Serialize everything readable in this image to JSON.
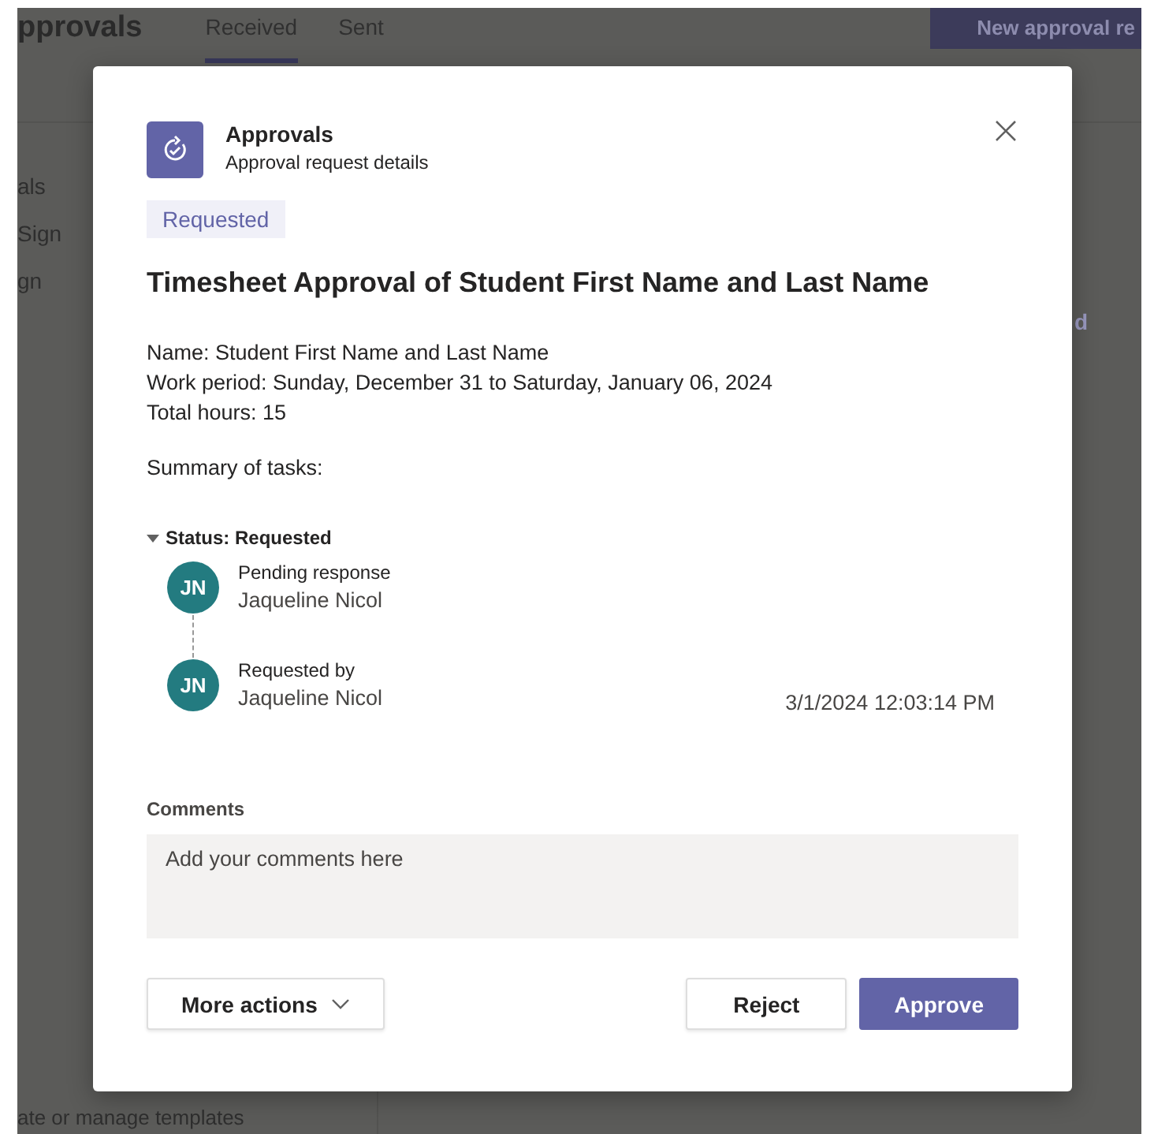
{
  "background": {
    "app_title": "pprovals",
    "tabs": [
      {
        "label": "Received",
        "selected": true
      },
      {
        "label": "Sent",
        "selected": false
      }
    ],
    "new_button": "New approval re",
    "sidebar_items": [
      "als",
      "Sign",
      "gn"
    ],
    "footer_link": "ate or manage templates",
    "right_fragment": "d"
  },
  "dialog": {
    "app_name": "Approvals",
    "app_subtitle": "Approval request details",
    "status_badge": "Requested",
    "title": "Timesheet Approval of Student First Name and Last Name",
    "details": [
      "Name: Student First Name and Last Name",
      "Work period: Sunday, December 31 to Saturday, January 06, 2024",
      "Total hours: 15"
    ],
    "summary": "Summary of tasks:",
    "status_section": {
      "label": "Status: Requested",
      "expanded": true,
      "entries": [
        {
          "initials": "JN",
          "label": "Pending response",
          "name": "Jaqueline Nicol"
        },
        {
          "initials": "JN",
          "label": "Requested by",
          "name": "Jaqueline Nicol",
          "time": "3/1/2024 12:03:14 PM"
        }
      ]
    },
    "comments": {
      "label": "Comments",
      "placeholder": "Add your comments here"
    },
    "buttons": {
      "more": "More actions",
      "reject": "Reject",
      "approve": "Approve"
    }
  }
}
